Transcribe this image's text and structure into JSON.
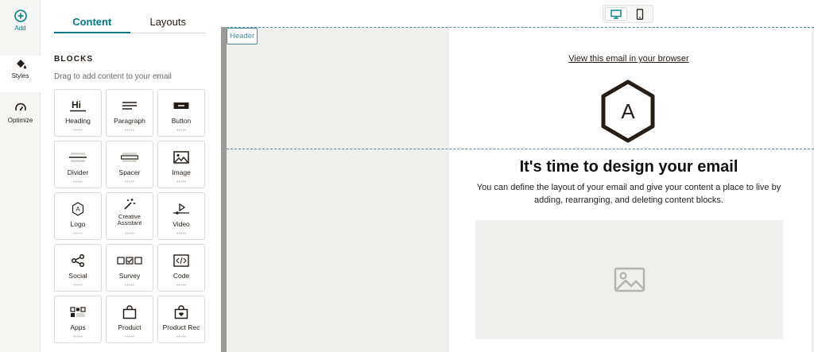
{
  "rail": {
    "add_label": "Add",
    "styles_label": "Styles",
    "optimize_label": "Optimize"
  },
  "panel": {
    "tabs": [
      {
        "label": "Content",
        "active": true
      },
      {
        "label": "Layouts",
        "active": false
      }
    ],
    "section_title": "BLOCKS",
    "section_subtitle": "Drag to add content to your email",
    "blocks": [
      {
        "label": "Heading",
        "icon": "heading-icon"
      },
      {
        "label": "Paragraph",
        "icon": "paragraph-icon"
      },
      {
        "label": "Button",
        "icon": "button-icon"
      },
      {
        "label": "Divider",
        "icon": "divider-icon"
      },
      {
        "label": "Spacer",
        "icon": "spacer-icon"
      },
      {
        "label": "Image",
        "icon": "image-icon"
      },
      {
        "label": "Logo",
        "icon": "logo-icon"
      },
      {
        "label": "Creative Assistant",
        "icon": "magic-wand-icon"
      },
      {
        "label": "Video",
        "icon": "video-icon"
      },
      {
        "label": "Social",
        "icon": "share-icon"
      },
      {
        "label": "Survey",
        "icon": "survey-icon"
      },
      {
        "label": "Code",
        "icon": "code-icon"
      },
      {
        "label": "Apps",
        "icon": "apps-icon"
      },
      {
        "label": "Product",
        "icon": "shopping-bag-icon"
      },
      {
        "label": "Product Rec",
        "icon": "product-rec-icon"
      }
    ]
  },
  "toolbar": {
    "device_desktop": "desktop-icon",
    "device_mobile": "mobile-icon",
    "active_device": "desktop"
  },
  "canvas": {
    "section_tag": "Header",
    "view_in_browser": "View this email in your browser",
    "logo_letter": "A",
    "headline": "It's time to design your email",
    "body": "You can define the layout of your email and give your content a place to live by adding, rearranging, and deleting content blocks."
  },
  "colors": {
    "accent": "#007c89",
    "text": "#241c15",
    "canvas_bg": "#efefed",
    "dashed_guide": "#4a8fa0"
  }
}
